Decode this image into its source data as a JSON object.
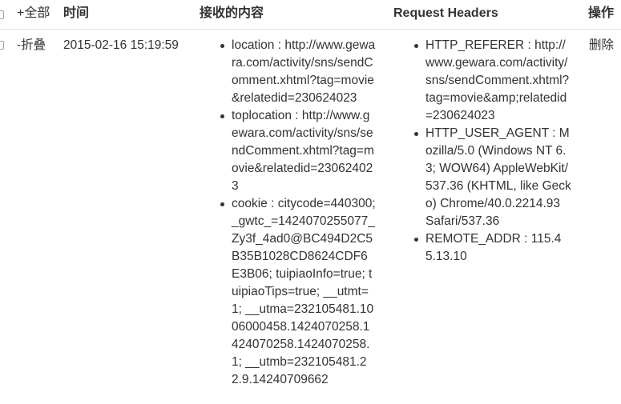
{
  "header": {
    "toggle_all": "+全部",
    "time": "时间",
    "content": "接收的内容",
    "headers": "Request Headers",
    "actions": "操作"
  },
  "row": {
    "collapse": "-折叠",
    "time": "2015-02-16 15:19:59",
    "content_items": [
      "location : http://www.gewara.com/activity/sns/sendComment.xhtml?tag=movie&relatedid=230624023",
      "toplocation : http://www.gewara.com/activity/sns/sendComment.xhtml?tag=movie&relatedid=230624023",
      "cookie : citycode=440300; _gwtc_=1424070255077_Zy3f_4ad0@BC494D2C5B35B1028CD8624CDF6E3B06; tuipiaoInfo=true; tuipiaoTips=true; __utmt=1; __utma=232105481.1006000458.1424070258.1424070258.1424070258.1; __utmb=232105481.22.9.14240709662"
    ],
    "header_items": [
      "HTTP_REFERER : http://www.gewara.com/activity/sns/sendComment.xhtml?tag=movie&amp;relatedid=230624023",
      "HTTP_USER_AGENT : Mozilla/5.0 (Windows NT 6.3; WOW64) AppleWebKit/537.36 (KHTML, like Gecko) Chrome/40.0.2214.93 Safari/537.36",
      "REMOTE_ADDR : 115.45.13.10"
    ],
    "delete": "删除"
  },
  "colors": {
    "link": "#5bb4d8",
    "text": "#333333",
    "divider": "#dddddd"
  }
}
